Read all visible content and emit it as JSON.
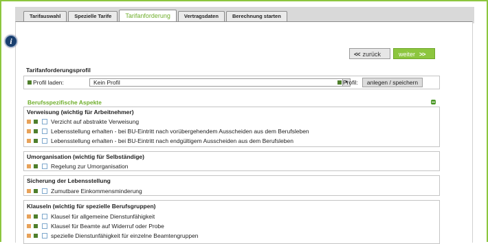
{
  "tabs": [
    "Tarifauswahl",
    "Spezielle Tarife",
    "Tarifanforderung",
    "Vertragsdaten",
    "Berechnung starten"
  ],
  "active_tab": "Tarifanforderung",
  "nav": {
    "back_label": "zurück",
    "next_label": "weiter",
    "back_arrows": "<<",
    "next_arrows": ">>"
  },
  "profile": {
    "section_title": "Tarifanforderungsprofil",
    "load_label": "Profil laden:",
    "selected": "Kein Profil",
    "profile_label": "Profil:",
    "save_button": "anlegen / speichern"
  },
  "group_title": "Berufsspezifische Aspekte",
  "sections": [
    {
      "title": "Verweisung (wichtig für Arbeitnehmer)",
      "items": [
        "Verzicht auf abstrakte Verweisung",
        "Lebensstellung erhalten - bei BU-Eintritt nach vorübergehendem Ausscheiden aus dem Berufsleben",
        "Lebensstellung erhalten - bei BU-Eintritt nach endgültigem Ausscheiden aus dem Berufsleben"
      ]
    },
    {
      "title": "Umorganisation (wichtig für Selbständige)",
      "items": [
        "Regelung zur Umorganisation"
      ]
    },
    {
      "title": "Sicherung der Lebensstellung",
      "items": [
        "Zumutbare Einkommensminderung"
      ]
    },
    {
      "title": "Klauseln (wichtig für spezielle Berufsgruppen)",
      "items": [
        "Klausel für allgemeine Dienstunfähigkeit",
        "Klausel für Beamte auf Widerruf oder Probe",
        "spezielle Dienstunfähigkeit für einzelne Beamtengruppen"
      ]
    }
  ],
  "colors": {
    "accent_green": "#8cc63e",
    "tag_orange": "#e7a25a",
    "tag_green": "#4f7f2c"
  }
}
